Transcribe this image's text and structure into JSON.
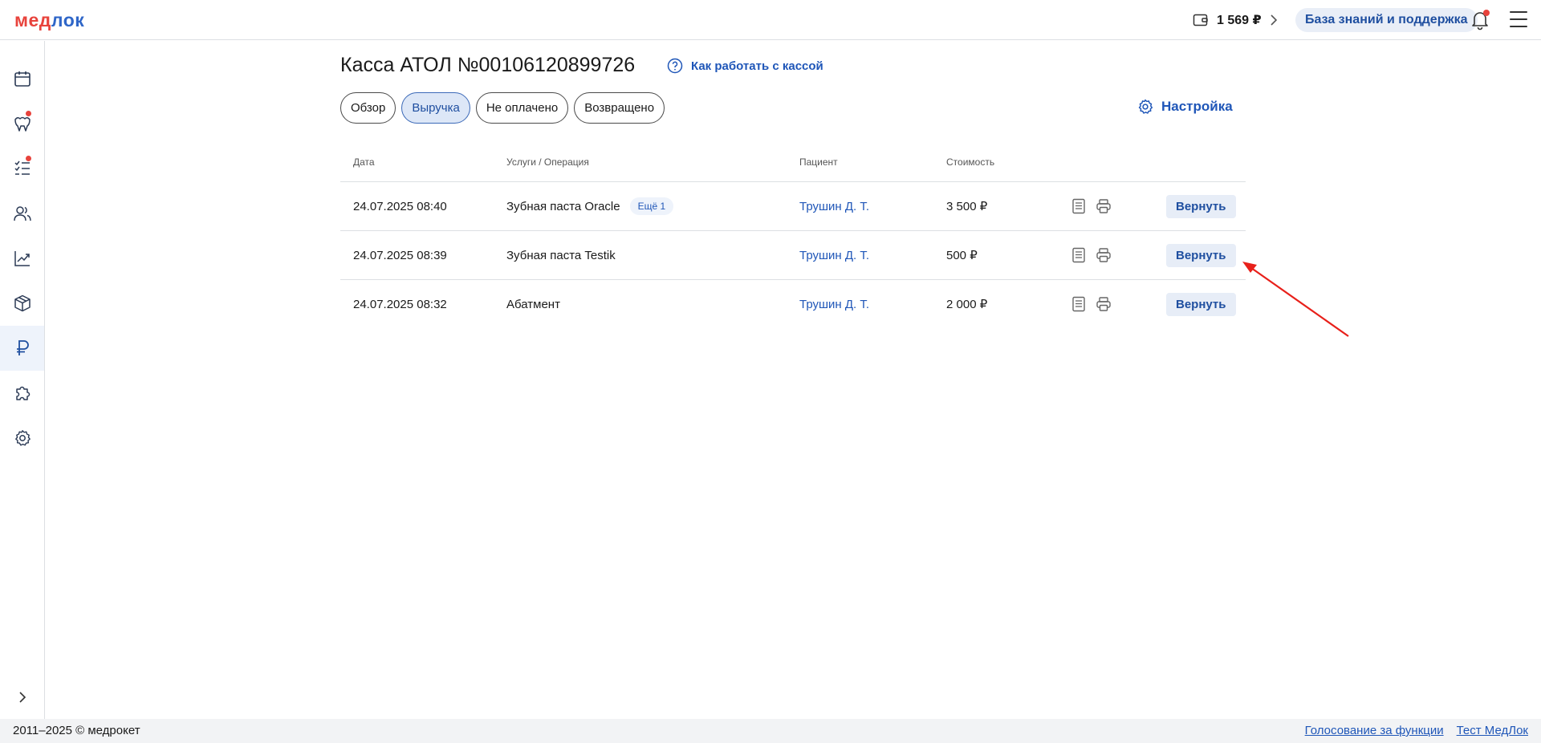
{
  "header": {
    "logo_left": "мед",
    "logo_right": "лок",
    "balance": "1 569 ₽",
    "kb_button": "База знаний и поддержка"
  },
  "sidebar": {
    "items": [
      {
        "icon": "calendar-icon"
      },
      {
        "icon": "tooth-icon",
        "badge": true
      },
      {
        "icon": "checklist-icon",
        "badge": true
      },
      {
        "icon": "users-icon"
      },
      {
        "icon": "chart-icon"
      },
      {
        "icon": "box-icon"
      },
      {
        "icon": "ruble-icon",
        "active": true
      },
      {
        "icon": "puzzle-icon"
      },
      {
        "icon": "gear-icon"
      }
    ]
  },
  "page": {
    "title": "Касса АТОЛ №00106120899726",
    "help_link": "Как работать с кассой",
    "settings_link": "Настройка",
    "tabs": [
      {
        "label": "Обзор",
        "active": false
      },
      {
        "label": "Выручка",
        "active": true
      },
      {
        "label": "Не оплачено",
        "active": false
      },
      {
        "label": "Возвращено",
        "active": false
      }
    ]
  },
  "table": {
    "columns": {
      "date": "Дата",
      "service": "Услуги / Операция",
      "patient": "Пациент",
      "cost": "Стоимость"
    },
    "rows": [
      {
        "date": "24.07.2025 08:40",
        "service": "Зубная паста Oracle",
        "more": "Ещё 1",
        "patient": "Трушин Д. Т.",
        "cost": "3 500 ₽",
        "action": "Вернуть"
      },
      {
        "date": "24.07.2025 08:39",
        "service": "Зубная паста Testik",
        "more": "",
        "patient": "Трушин Д. Т.",
        "cost": "500 ₽",
        "action": "Вернуть"
      },
      {
        "date": "24.07.2025 08:32",
        "service": "Абатмент",
        "more": "",
        "patient": "Трушин Д. Т.",
        "cost": "2 000 ₽",
        "action": "Вернуть"
      }
    ]
  },
  "footer": {
    "copyright": "2011–2025 © медрокет",
    "vote_link": "Голосование за функции",
    "test_link": "Тест МедЛок"
  },
  "colors": {
    "accent": "#1f56b8",
    "brand_red": "#e8433c",
    "annotation_arrow": "#e8201a"
  }
}
